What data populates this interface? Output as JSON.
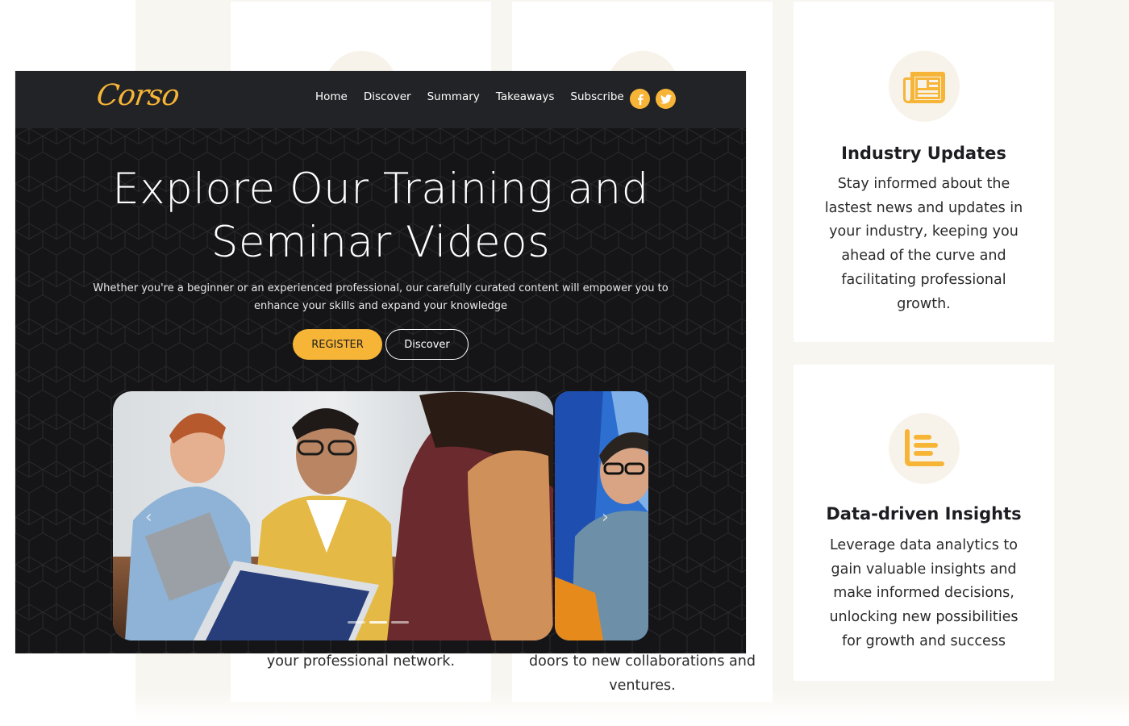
{
  "brand": {
    "logo_text": "Corso",
    "accent_color": "#f7b538",
    "background_color": "#f8f6f0",
    "dark_color": "#151517"
  },
  "nav": {
    "links": [
      "Home",
      "Discover",
      "Summary",
      "Takeaways",
      "Subscribe"
    ],
    "social": [
      {
        "name": "facebook",
        "glyph": "f",
        "icon": "facebook-icon"
      },
      {
        "name": "twitter",
        "icon": "twitter-icon"
      }
    ]
  },
  "hero": {
    "title": "Explore Our Training and Seminar Videos",
    "subtitle": "Whether you're a beginner or an experienced professional, our carefully curated content will empower you to enhance your skills and expand your knowledge",
    "register_label": "REGISTER",
    "discover_label": "Discover",
    "slider": {
      "prev_glyph": "‹",
      "next_glyph": "›",
      "slides": [
        "slide-1",
        "slide-2"
      ],
      "active_index": 1
    }
  },
  "cards": [
    {
      "icon": "newspaper-icon",
      "title": "Industry Updates",
      "text": "Stay informed about the lastest news and updates in your industry, keeping you ahead of the curve and facilitating professional growth."
    },
    {
      "icon": "data-list-icon",
      "title": "Data-driven Insights",
      "text": "Leverage data analytics to gain valuable insights and make informed decisions, unlocking new possibilities for growth and success"
    }
  ],
  "partial_cards": [
    {
      "text": "your professional network."
    },
    {
      "text": "doors to new collaborations and ventures."
    }
  ]
}
